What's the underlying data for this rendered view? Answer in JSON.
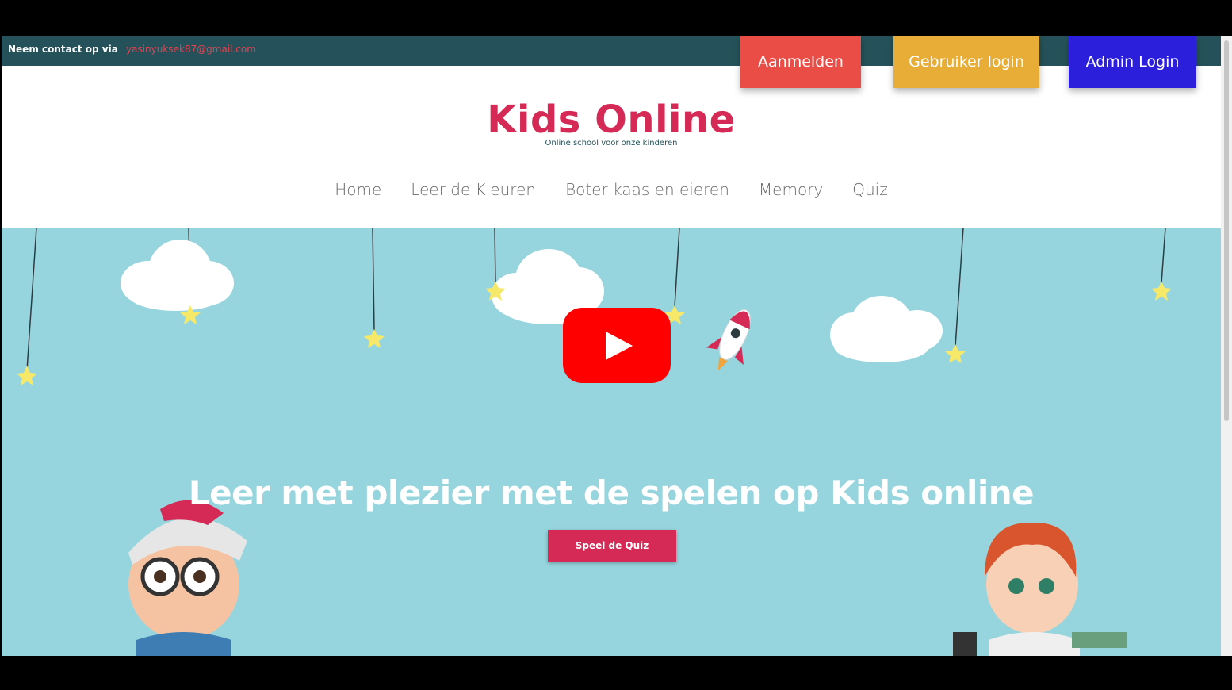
{
  "topbar": {
    "contact_label": "Neem contact op via",
    "contact_email": "yasinyuksek87@gmail.com"
  },
  "auth": {
    "signup": "Aanmelden",
    "user_login": "Gebruiker login",
    "admin_login": "Admin Login"
  },
  "brand": {
    "title": "Kids Online",
    "subtitle": "Online school voor onze kinderen"
  },
  "nav": [
    "Home",
    "Leer de Kleuren",
    "Boter kaas en eieren",
    "Memory",
    "Quiz"
  ],
  "hero": {
    "headline": "Leer met plezier met de spelen op Kids online",
    "cta": "Speel de Quiz"
  },
  "colors": {
    "topbar": "#25525a",
    "brand": "#d42a55",
    "hero_bg": "#97d5de",
    "signup": "#ea4c46",
    "user_login": "#e7ad37",
    "admin_login": "#2b1fdb",
    "play": "#ff0000"
  },
  "icons": [
    "play-icon",
    "cloud-icon",
    "star-icon",
    "rocket-icon"
  ]
}
